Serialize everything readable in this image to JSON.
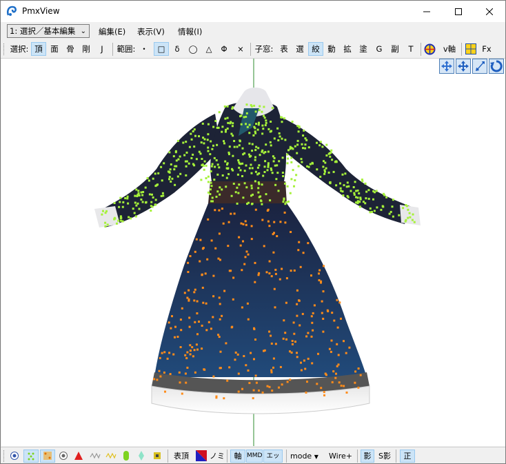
{
  "window": {
    "title": "PmxView"
  },
  "menu": {
    "mode_select": "1: 選択／基本編集",
    "items": [
      "編集(E)",
      "表示(V)",
      "情報(I)"
    ]
  },
  "toolbar": {
    "select_label": "選択:",
    "select_items": [
      "頂",
      "面",
      "骨",
      "剛",
      "J"
    ],
    "range_label": "範囲:",
    "range_items": [
      "・",
      "□",
      "δ",
      "◯",
      "△",
      "Φ",
      "×"
    ],
    "child_label": "子窓:",
    "child_items": [
      "表",
      "選",
      "絞",
      "動",
      "拡",
      "塗",
      "G",
      "副",
      "T"
    ],
    "vaxis_label": "v軸",
    "fx_label": "Fx"
  },
  "status": {
    "show_vertex": "表頂",
    "nomi": "ノミ",
    "axis": "軸",
    "mmd": "MMD",
    "edge": "エッジ",
    "mode": "mode",
    "wire": "Wire+",
    "shadow": "影",
    "s_shadow": "S影",
    "ortho": "正"
  },
  "colors": {
    "accent_on": "#cce4f7",
    "selected_vertex": "#a6f23a",
    "unselected_vertex": "#ff8c1a",
    "dress_top": "#1d2336",
    "dress_skirt": "#1f3d66",
    "axis_line": "#2e8b2e"
  },
  "icons": [
    "app-icon",
    "minimize-icon",
    "maximize-icon",
    "close-icon",
    "vaxis-icon",
    "fx-icon",
    "move-view-icon",
    "pan-view-icon",
    "zoom-view-icon",
    "rotate-view-icon"
  ]
}
